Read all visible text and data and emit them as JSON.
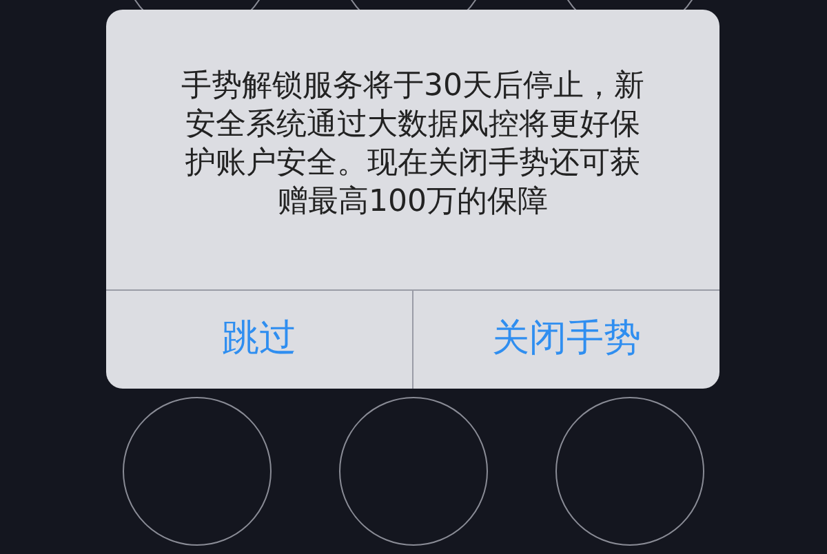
{
  "alert": {
    "message": "手势解锁服务将于30天后停止，新安全系统通过大数据风控将更好保护账户安全。现在关闭手势还可获赠最高100万的保障",
    "buttons": [
      {
        "label": "跳过"
      },
      {
        "label": "关闭手势"
      }
    ]
  }
}
